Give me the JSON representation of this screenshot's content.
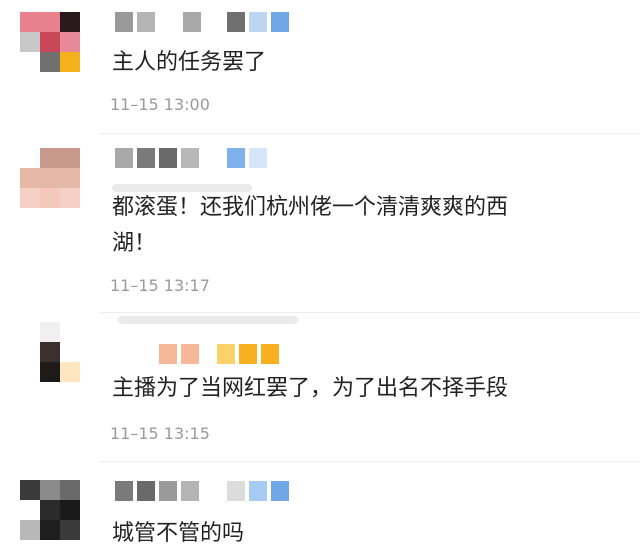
{
  "comments": [
    {
      "content": "主人的任务罢了",
      "time": "11–15 13:00"
    },
    {
      "content_line1": "都滚蛋！还我们杭州佬一个清清爽爽的西",
      "content_line2": "湖！",
      "time": "11–15 13:17"
    },
    {
      "content": "主播为了当网红罢了，为了出名不择手段",
      "time": "11–15 13:15"
    },
    {
      "content": "城管不管的吗"
    }
  ],
  "colors": {
    "text": "#222222",
    "timestamp": "#9a9a9a",
    "divider": "#ececec",
    "background": "#ffffff"
  },
  "icons": [
    "pixelated-avatar",
    "pixelated-username"
  ]
}
